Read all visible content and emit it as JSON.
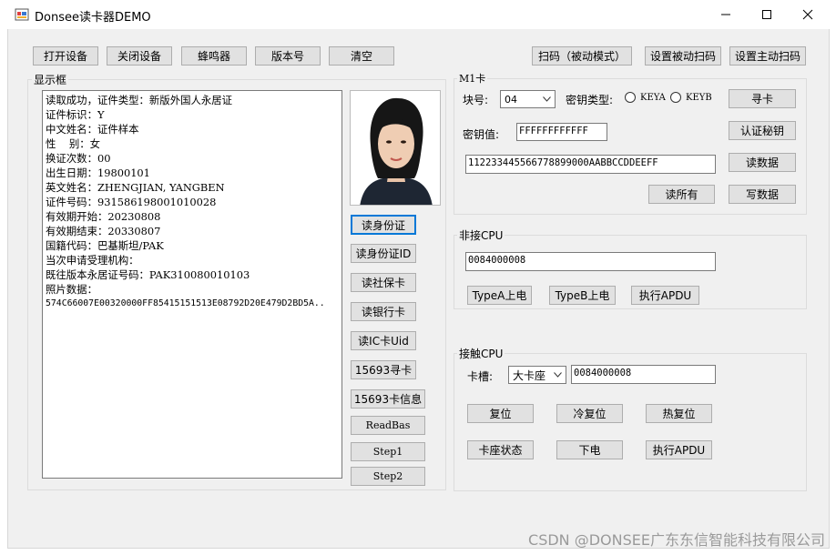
{
  "window": {
    "title": "Donsee读卡器DEMO",
    "minimize": "—",
    "maximize": "☐",
    "close": "✕"
  },
  "toolbar": {
    "open": "打开设备",
    "close": "关闭设备",
    "beep": "蜂鸣器",
    "version": "版本号",
    "clear": "清空",
    "scan_passive": "扫码（被动模式）",
    "set_passive": "设置被动扫码",
    "set_active": "设置主动扫码"
  },
  "display": {
    "label": "显示框",
    "lines": [
      "读取成功，证件类型：新版外国人永居证",
      "证件标识：Y",
      "中文姓名：证件样本",
      "性    别：女",
      "换证次数：00",
      "出生日期：19800101",
      "英文姓名：ZHENGJIAN, YANGBEN",
      "证件号码：931586198001010028",
      "有效期开始：20230808",
      "有效期结束：20330807",
      "国籍代码：巴基斯坦/PAK",
      "当次申请受理机构：",
      "既往版本永居证号码：PAK310080010103",
      "照片数据：",
      "574C66007E00320000FF85415151513E08792D20E479D2BD5A.."
    ]
  },
  "actions": {
    "read_id": "读身份证",
    "read_id_uid": "读身份证ID",
    "read_social": "读社保卡",
    "read_bank": "读银行卡",
    "read_ic_uid": "读IC卡Uid",
    "find_15693": "15693寻卡",
    "info_15693": "15693卡信息",
    "readbas": "ReadBas",
    "step1": "Step1",
    "step2": "Step2"
  },
  "m1": {
    "label": "M1卡",
    "block_label": "块号:",
    "block_value": "04",
    "keytype_label": "密钥类型:",
    "keya": "KEYA",
    "keyb": "KEYB",
    "find": "寻卡",
    "key_label": "密钥值:",
    "key_value": "FFFFFFFFFFFF",
    "auth": "认证秘钥",
    "data_value": "112233445566778899000AABBCCDDEEFF",
    "read_data": "读数据",
    "read_all": "读所有",
    "write_data": "写数据"
  },
  "contactless": {
    "label": "非接CPU",
    "value": "0084000008",
    "typea": "TypeA上电",
    "typeb": "TypeB上电",
    "apdu": "执行APDU"
  },
  "contact": {
    "label": "接触CPU",
    "slot_label": "卡槽:",
    "slot_value": "大卡座",
    "value": "0084000008",
    "reset": "复位",
    "cold": "冷复位",
    "hot": "热复位",
    "status": "卡座状态",
    "poweroff": "下电",
    "apdu": "执行APDU"
  },
  "watermark": "CSDN @DONSEE广东东信智能科技有限公司"
}
